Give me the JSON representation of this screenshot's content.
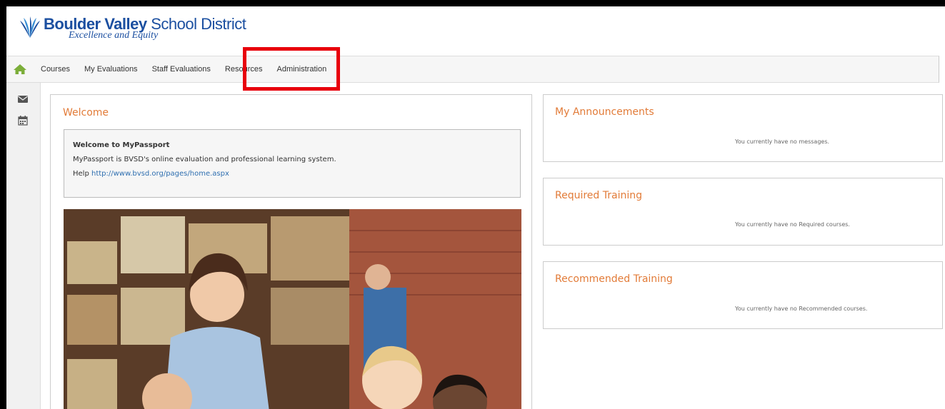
{
  "header": {
    "logo_bold": "Boulder Valley",
    "logo_rest": " School District",
    "logo_tagline": "Excellence and Equity"
  },
  "nav": {
    "items": [
      "Courses",
      "My Evaluations",
      "Staff Evaluations",
      "Resources",
      "Administration"
    ],
    "highlighted": "Administration"
  },
  "sidebar": {
    "icons": [
      "mail-icon",
      "calendar-icon"
    ]
  },
  "welcome": {
    "title": "Welcome",
    "box_title": "Welcome to MyPassport",
    "box_text": "MyPassport is BVSD's online evaluation and professional learning system.",
    "help_label": "Help ",
    "help_link": "http://www.bvsd.org/pages/home.aspx"
  },
  "announcements": {
    "title": "My Announcements",
    "message": "You currently have no messages."
  },
  "required": {
    "title": "Required Training",
    "message": "You currently have no Required courses."
  },
  "recommended": {
    "title": "Recommended Training",
    "message": "You currently have no Recommended courses."
  },
  "colors": {
    "accent": "#e27b38",
    "brand": "#1b4fa0",
    "highlight": "#e8000b",
    "link": "#2f6fb0"
  }
}
